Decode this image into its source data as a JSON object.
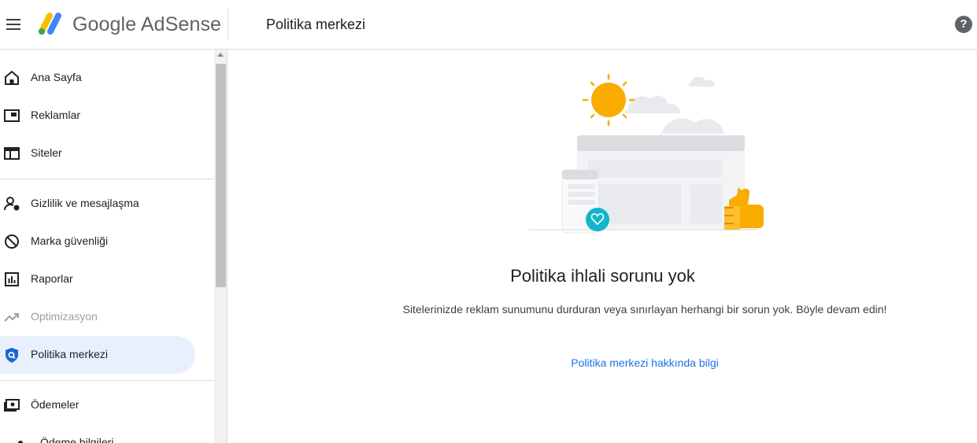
{
  "header": {
    "brand": "Google AdSense",
    "page_title": "Politika merkezi",
    "help_symbol": "?"
  },
  "sidebar": {
    "items": [
      {
        "label": "Ana Sayfa",
        "icon": "home-icon"
      },
      {
        "label": "Reklamlar",
        "icon": "ads-icon"
      },
      {
        "label": "Siteler",
        "icon": "sites-icon"
      },
      {
        "label": "Gizlilik ve mesajlaşma",
        "icon": "privacy-icon"
      },
      {
        "label": "Marka güvenliği",
        "icon": "block-icon"
      },
      {
        "label": "Raporlar",
        "icon": "reports-icon"
      },
      {
        "label": "Optimizasyon",
        "icon": "trending-icon",
        "disabled": true
      },
      {
        "label": "Politika merkezi",
        "icon": "policy-shield-icon",
        "active": true
      },
      {
        "label": "Ödemeler",
        "icon": "payments-icon"
      }
    ],
    "sub_item": "Ödeme bilgileri"
  },
  "main": {
    "heading": "Politika ihlali sorunu yok",
    "description": "Sitelerinizde reklam sunumunu durduran veya sınırlayan herhangi bir sorun yok. Böyle devam edin!",
    "link": "Politika merkezi hakkında bilgi"
  },
  "colors": {
    "accent": "#1a73e8",
    "active_bg": "#e8f0fe",
    "sun": "#f9ab00",
    "teal": "#12b5cb"
  }
}
